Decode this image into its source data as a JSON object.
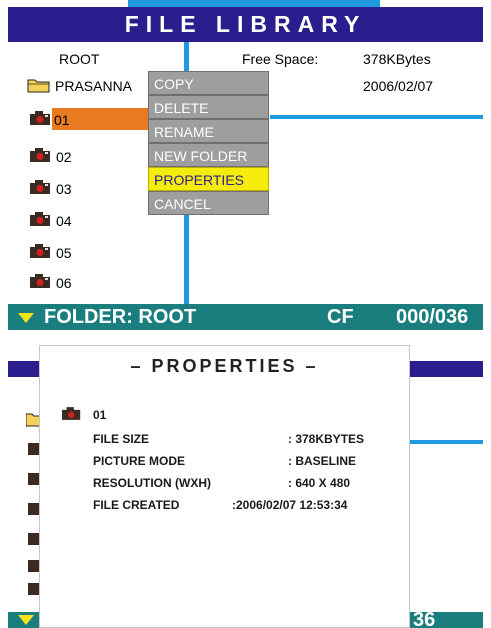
{
  "screen1": {
    "title": "FILE LIBRARY",
    "root_label": "ROOT",
    "free_space_label": "Free Space:",
    "free_space_value": "378KBytes",
    "folder_name": "PRASANNA",
    "folder_date": "2006/02/07",
    "files": [
      "01",
      "02",
      "03",
      "04",
      "05",
      "06"
    ],
    "context_menu": [
      "COPY",
      "DELETE",
      "RENAME",
      "NEW FOLDER",
      "PROPERTIES",
      "CANCEL"
    ],
    "selected_menu_item": "PROPERTIES",
    "status_folder": "FOLDER: ROOT",
    "status_media": "CF",
    "status_count": "000/036"
  },
  "screen2": {
    "dialog_title": "– PROPERTIES –",
    "file_name": "01",
    "properties": [
      {
        "label": "FILE SIZE",
        "value": ": 378KBYTES"
      },
      {
        "label": "PICTURE MODE",
        "value": ": BASELINE"
      },
      {
        "label": "RESOLUTION (WXH)",
        "value": ": 640 X 480"
      },
      {
        "label": "FILE CREATED",
        "value": ":2006/02/07 12:53:34"
      }
    ],
    "status_count_partial": "36"
  },
  "colors": {
    "title_bar": "#2a1e8f",
    "accent_blue": "#1f9ae0",
    "status_bar": "#1b7e7e",
    "selection_orange": "#e87a1f",
    "menu_gray": "#9e9e9e",
    "menu_highlight": "#f5ec0c",
    "status_arrow": "#f2e418"
  },
  "icons": {
    "folder": "folder-icon",
    "file": "camera-icon",
    "status": "triangle-down-icon"
  }
}
